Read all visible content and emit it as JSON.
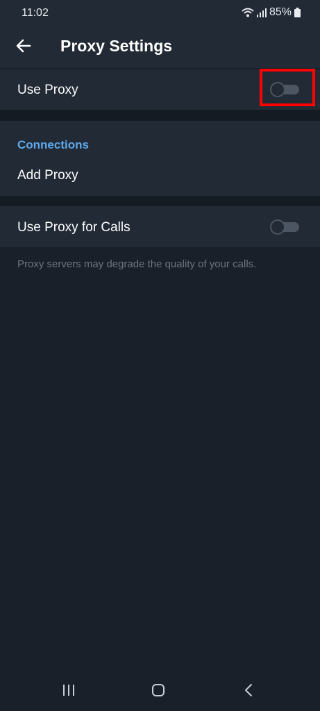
{
  "status_bar": {
    "time": "11:02",
    "battery": "85%",
    "icons": [
      "wifi-icon",
      "signal-icon",
      "battery-icon"
    ]
  },
  "header": {
    "title": "Proxy Settings",
    "back_icon": "arrow-left-icon"
  },
  "settings": {
    "use_proxy": {
      "label": "Use Proxy",
      "enabled": false
    },
    "connections": {
      "section_title": "Connections",
      "add_proxy_label": "Add Proxy"
    },
    "use_proxy_for_calls": {
      "label": "Use Proxy for Calls",
      "enabled": false
    },
    "calls_note": "Proxy servers may degrade the quality of your calls."
  },
  "nav_bar": {
    "icons": [
      "recent-apps-icon",
      "home-icon",
      "back-icon"
    ]
  },
  "colors": {
    "background": "#19202a",
    "surface": "#222a35",
    "accent": "#5ea9ec",
    "highlight": "#ff0000"
  }
}
